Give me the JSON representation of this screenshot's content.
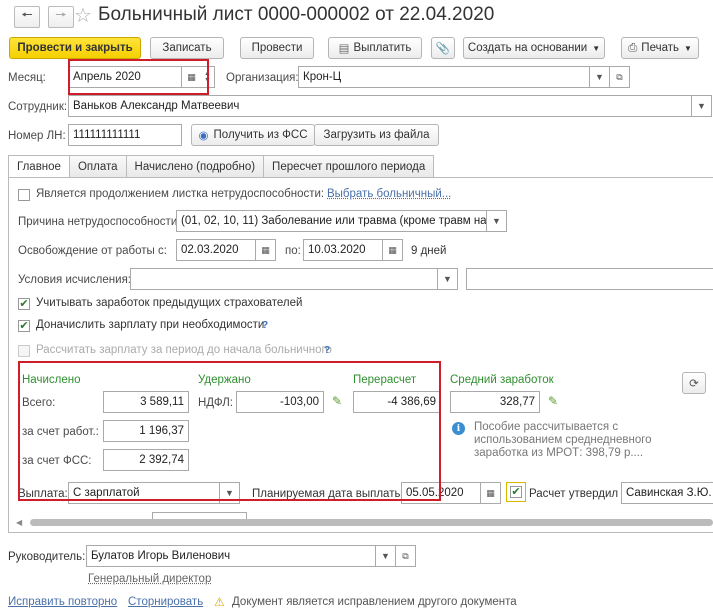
{
  "window": {
    "title": "Больничный лист 0000-000002 от 22.04.2020"
  },
  "toolbar": {
    "post_and_close": "Провести и закрыть",
    "save": "Записать",
    "post": "Провести",
    "pay": "Выплатить",
    "create_based": "Создать на основании",
    "print": "Печать"
  },
  "header": {
    "month_label": "Месяц:",
    "month_value": "Апрель 2020",
    "org_label": "Организация:",
    "org_value": "Крон-Ц",
    "employee_label": "Сотрудник:",
    "employee_value": "Ваньков Александр Матвеевич",
    "ln_label": "Номер ЛН:",
    "ln_value": "111111111111",
    "get_fss": "Получить из ФСС",
    "load_file": "Загрузить из файла"
  },
  "tabs": [
    {
      "label": "Главное"
    },
    {
      "label": "Оплата"
    },
    {
      "label": "Начислено (подробно)"
    },
    {
      "label": "Пересчет прошлого периода"
    }
  ],
  "main": {
    "continuation_label": "Является продолжением листка нетрудоспособности:",
    "continuation_link": "Выбрать больничный...",
    "reason_label": "Причина нетрудоспособности:",
    "reason_value": "(01, 02, 10, 11) Заболевание или травма (кроме травм на п",
    "release_label": "Освобождение от работы с:",
    "date_from": "02.03.2020",
    "to_label": "по:",
    "date_to": "10.03.2020",
    "days": "9 дней",
    "conditions_label": "Условия исчисления:",
    "prev_employers_label": "Учитывать заработок предыдущих страхователей",
    "add_salary_label": "Доначислить зарплату при необходимости",
    "q1": "?",
    "calc_before_label": "Рассчитать зарплату за период до начала больничного",
    "q2": "?"
  },
  "amounts": {
    "accrued_header": "Начислено",
    "withheld_header": "Удержано",
    "recalc_header": "Перерасчет",
    "avg_header": "Средний заработок",
    "total_label": "Всего:",
    "total_value": "3 589,11",
    "employer_label": "за счет работ.:",
    "employer_value": "1 196,37",
    "fss_label": "за счет ФСС:",
    "fss_value": "2 392,74",
    "ndfl_label": "НДФЛ:",
    "ndfl_value": "-103,00",
    "recalc_value": "-4 386,69",
    "avg_value": "328,77",
    "note_line1": "Пособие рассчитывается с",
    "note_line2": "использованием среднедневного",
    "note_line3": "заработка из МРОТ: 398,79 р...."
  },
  "payment": {
    "label": "Выплата:",
    "value": "С зарплатой",
    "planned_label": "Планируемая дата выплаты:",
    "planned_value": "05.05.2020",
    "approved_label": "Расчет утвердил",
    "approved_value": "Савинская З.Ю. ("
  },
  "footer": {
    "head_label": "Руководитель:",
    "head_value": "Булатов Игорь Виленович",
    "position": "Генеральный директор",
    "fix_again": "Исправить повторно",
    "reverse": "Сторнировать",
    "warning": "Документ является исправлением другого документа"
  }
}
